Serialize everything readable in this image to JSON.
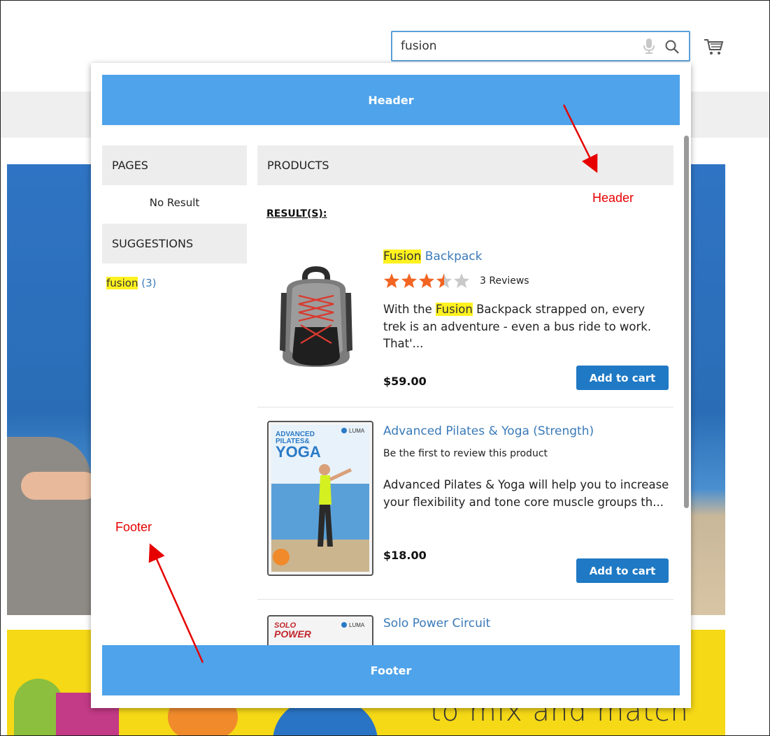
{
  "search": {
    "value": "fusion",
    "placeholder": ""
  },
  "dropdown": {
    "header_label": "Header",
    "footer_label": "Footer",
    "pages": {
      "title": "PAGES",
      "empty_text": "No Result"
    },
    "suggestions": {
      "title": "SUGGESTIONS",
      "items": [
        {
          "term": "fusion",
          "count": "(3)"
        }
      ]
    },
    "products": {
      "title": "PRODUCTS",
      "results_label": "RESULT(S):",
      "items": [
        {
          "name_highlight": "Fusion",
          "name_rest": " Backpack",
          "rating": 3.5,
          "review_text": "3 Reviews",
          "desc_before": "With the ",
          "desc_highlight": "Fusion",
          "desc_after": " Backpack strapped on, every trek is an adventure - even a bus ride to work. That'...",
          "price": "$59.00",
          "button": "Add to cart"
        },
        {
          "name": "Advanced Pilates & Yoga (Strength)",
          "review_text": "Be the first to review this product",
          "description": "Advanced Pilates & Yoga will help you to increase your flexibility and tone core muscle groups th...",
          "price": "$18.00",
          "button": "Add to cart",
          "cover": {
            "title_line1": "ADVANCED",
            "title_line2": "PILATES&",
            "title_line3": "YOGA",
            "brand": "LUMA"
          }
        },
        {
          "name": "Solo Power Circuit",
          "cover": {
            "title_line1": "SOLO",
            "title_line2": "POWER",
            "brand": "LUMA"
          }
        }
      ]
    }
  },
  "annotations": {
    "header": "Header",
    "footer": "Footer"
  },
  "background": {
    "banner_text": "to mix and match"
  },
  "colors": {
    "accent": "#4fa3ea",
    "button": "#1f79c4",
    "link": "#3a7ab8",
    "highlight": "#fff21f",
    "annotation": "#e60000",
    "star": "#f26522"
  },
  "icons": {
    "mic": "microphone-icon",
    "search": "search-icon",
    "cart": "cart-icon"
  }
}
